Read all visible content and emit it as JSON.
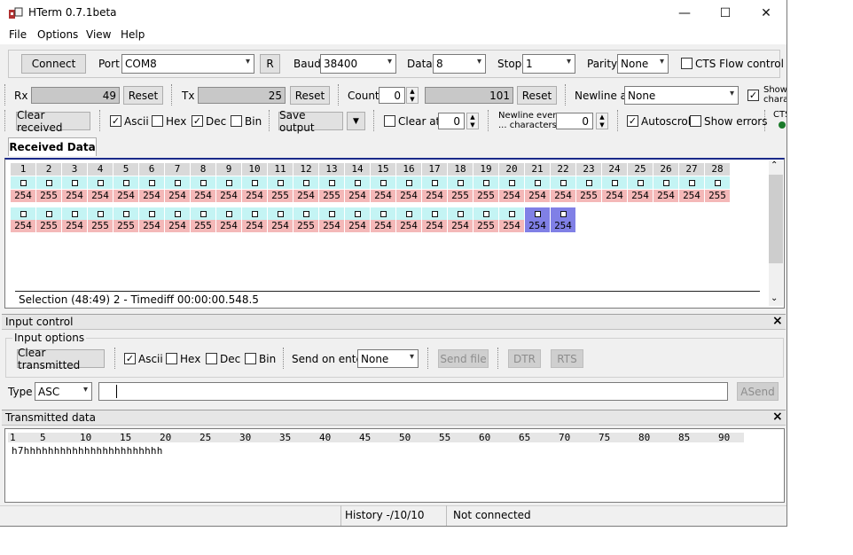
{
  "window": {
    "title": "HTerm 0.7.1beta",
    "minimize": "—",
    "maximize": "☐",
    "close": "✕"
  },
  "menu": [
    "File",
    "Options",
    "View",
    "Help"
  ],
  "connection": {
    "connect_label": "Connect",
    "port_label": "Port",
    "port_value": "COM8",
    "r_label": "R",
    "baud_label": "Baud",
    "baud_value": "38400",
    "data_label": "Data",
    "data_value": "8",
    "stop_label": "Stop",
    "stop_value": "1",
    "parity_label": "Parity",
    "parity_value": "None",
    "cts_label": "CTS Flow control"
  },
  "counters": {
    "rx_label": "Rx",
    "rx_value": "49",
    "rx_reset": "Reset",
    "tx_label": "Tx",
    "tx_value": "25",
    "tx_reset": "Reset",
    "count_label": "Count",
    "count_value": "0",
    "count_bar": "101",
    "count_reset": "Reset",
    "newline_label": "Newline at",
    "newline_value": "None",
    "show_label_1": "Show",
    "show_label_2": "charac"
  },
  "receive_toolbar": {
    "clear_received": "Clear received",
    "ascii": "Ascii",
    "hex": "Hex",
    "dec": "Dec",
    "bin": "Bin",
    "save_output": "Save output",
    "clear_at": "Clear at",
    "clear_at_value": "0",
    "newline_every_1": "Newline every",
    "newline_every_2": "... characters",
    "newline_every_value": "0",
    "autoscroll": "Autoscroll",
    "show_errors": "Show errors",
    "cts": "CTS"
  },
  "received": {
    "tab": "Received Data",
    "row1_index": [
      "1",
      "2",
      "3",
      "4",
      "5",
      "6",
      "7",
      "8",
      "9",
      "10",
      "11",
      "12",
      "13",
      "14",
      "15",
      "16",
      "17",
      "18",
      "19",
      "20",
      "21",
      "22",
      "23",
      "24",
      "25",
      "26",
      "27",
      "28"
    ],
    "row1_dec": [
      "254",
      "255",
      "254",
      "254",
      "254",
      "254",
      "254",
      "254",
      "254",
      "254",
      "255",
      "254",
      "255",
      "254",
      "254",
      "254",
      "254",
      "255",
      "255",
      "254",
      "254",
      "254",
      "255",
      "254",
      "254",
      "254",
      "254",
      "255"
    ],
    "row2_dec": [
      "254",
      "255",
      "254",
      "255",
      "255",
      "254",
      "254",
      "255",
      "254",
      "254",
      "254",
      "255",
      "254",
      "254",
      "254",
      "254",
      "254",
      "254",
      "255",
      "254",
      "254",
      "254"
    ],
    "selected": [
      21,
      22
    ],
    "status": "Selection (48:49) 2  -  Timediff 00:00:00.548.5"
  },
  "input_control": {
    "title": "Input control",
    "options_title": "Input options",
    "clear_transmitted": "Clear transmitted",
    "ascii": "Ascii",
    "hex": "Hex",
    "dec": "Dec",
    "bin": "Bin",
    "send_on_enter_label": "Send on enter",
    "send_on_enter_value": "None",
    "send_file": "Send file",
    "dtr": "DTR",
    "rts": "RTS",
    "type_label": "Type",
    "type_value": "ASC",
    "asend": "ASend"
  },
  "transmitted": {
    "title": "Transmitted data",
    "ruler": [
      "1",
      "5",
      "10",
      "15",
      "20",
      "25",
      "30",
      "35",
      "40",
      "45",
      "50",
      "55",
      "60",
      "65",
      "70",
      "75",
      "80",
      "85",
      "90"
    ],
    "content": "h7hhhhhhhhhhhhhhhhhhhhhhh"
  },
  "statusbar": {
    "history": "History -/10/10",
    "connection": "Not connected"
  }
}
